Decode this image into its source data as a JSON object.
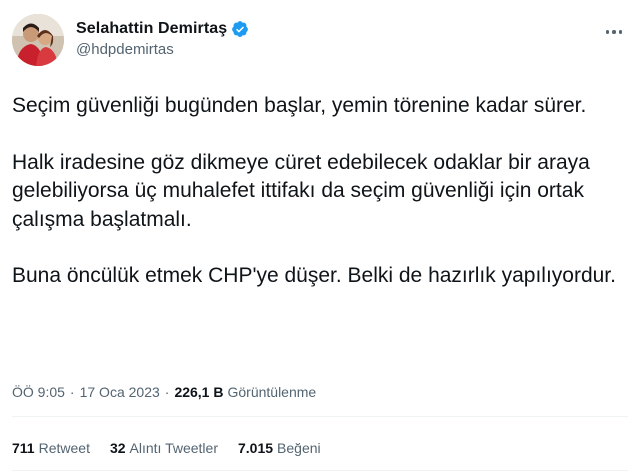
{
  "author": {
    "display_name": "Selahattin Demirtaş",
    "handle": "@hdpdemirtas",
    "verified_color": "#1d9bf0"
  },
  "tweet": {
    "paragraphs": [
      "Seçim güvenliği bugünden başlar, yemin törenine kadar sürer.",
      "Halk iradesine göz dikmeye cüret edebilecek odaklar bir araya gelebiliyorsa üç muhalefet ittifakı da seçim güvenliği için ortak çalışma başlatmalı.",
      "Buna öncülük etmek CHP'ye düşer. Belki de hazırlık yapılıyordur."
    ]
  },
  "meta": {
    "time": "ÖÖ 9:05",
    "separator": "·",
    "date": "17 Oca 2023",
    "views_count": "226,1 B",
    "views_label": "Görüntülenme"
  },
  "stats": {
    "retweets_count": "711",
    "retweets_label": "Retweet",
    "quotes_count": "32",
    "quotes_label": "Alıntı Tweetler",
    "likes_count": "7.015",
    "likes_label": "Beğeni"
  }
}
